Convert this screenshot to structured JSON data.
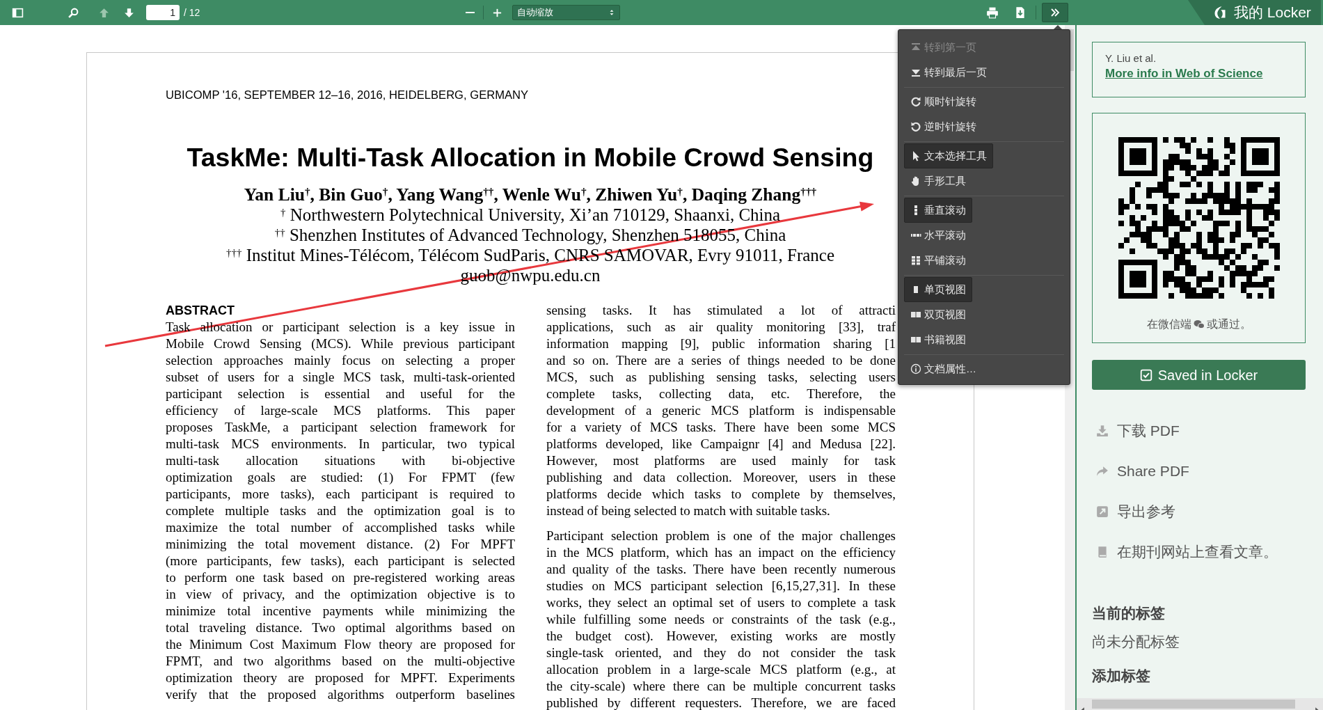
{
  "toolbar": {
    "page_value": "1",
    "page_total": "/ 12",
    "zoom": "自动缩放",
    "previous_disabled": true,
    "menu_open": true
  },
  "locker_tab": {
    "title": "我的 Locker"
  },
  "document": {
    "running_head": "UBICOMP '16, SEPTEMBER 12–16, 2016, HEIDELBERG, GERMANY",
    "title": "TaskMe: Multi-Task Allocation in Mobile Crowd Sensing",
    "authors": "Yan Liu$^{†}$, Bin Guo$^{†}$, Yang Wang$^{††}$, Wenle Wu$^{†}$, Zhiwen Yu$^{†}$, Daqing Zhang$^{†††}$",
    "affiliations": [
      "$^{†}$ Northwestern Polytechnical University, Xi’an 710129, Shaanxi, China",
      "$^{††}$ Shenzhen Institutes of Advanced Technology, Shenzhen 518055, China",
      "$^{†††}$ Institut Mines-Télécom, Télécom SudParis, CNRS SAMOVAR, Evry 91011, France"
    ],
    "email": "guob@nwpu.edu.cn",
    "columns": [
      {
        "heading": "ABSTRACT",
        "paragraphs": [
          {
            "lines": [
              "Task allocation or participant selection is a key issue in",
              "Mobile Crowd Sensing (MCS). While previous participant",
              "selection approaches mainly focus on selecting a proper",
              "subset of users for a single MCS task, multi-task-oriented",
              "participant selection is essential and useful for the",
              "efficiency of large-scale MCS platforms. This paper",
              "proposes TaskMe, a participant selection framework for",
              "multi-task MCS environments. In particular, two typical",
              "multi-task allocation situations with bi-objective",
              "optimization goals are studied: (1) For FPMT (few",
              "participants, more tasks), each participant is required to",
              "complete multiple tasks and the optimization goal is to",
              "maximize the total number of accomplished tasks while",
              "minimizing the total movement distance. (2) For MPFT",
              "(more participants, few tasks), each participant is selected",
              "to perform one task based on pre-registered working areas",
              "in view of privacy, and the optimization objective is to",
              "minimize total incentive payments while minimizing the",
              "total traveling distance. Two optimal algorithms based on",
              "the Minimum Cost Maximum Flow theory are proposed for",
              "FPMT, and two algorithms based on the multi-objective",
              "optimization theory are proposed for MPFT. Experiments",
              "verify that the proposed algorithms outperform baselines"
            ]
          }
        ]
      },
      {
        "paragraphs": [
          {
            "lines": [
              "sensing tasks. It has stimulated a lot of attracti",
              "applications, such as air quality monitoring [33], traf",
              "information mapping [9], public information sharing [1",
              "and so on. There are a series of things needed to be done",
              "MCS, such as publishing sensing tasks, selecting users",
              "complete tasks, collecting data, etc. Therefore, the",
              "development of a generic MCS platform is indispensable",
              "for a variety of MCS tasks. There have been some MCS",
              "platforms developed, like Campaignr [4] and Medusa [22].",
              "However, most platforms are used mainly for task",
              "publishing and data collection. Moreover, users in these",
              "platforms decide which tasks to complete by themselves,",
              "instead of being selected to match with suitable tasks."
            ]
          },
          {
            "lines": [
              "Participant selection problem is one of the major challenges",
              "in the MCS platform, which has an impact on the efficiency",
              "and quality of the tasks. There have been recently numerous",
              "studies on MCS participant selection [6,15,27,31]. In these",
              "works, they select an optimal set of users to complete a task",
              "while fulfilling some needs or constraints of the task (e.g.,",
              "the budget cost). However, existing works are mostly",
              "single-task oriented, and they do not consider the task",
              "allocation problem in a large-scale MCS platform (e.g., at",
              "the city-scale) where there can be multiple concurrent tasks",
              "published by different requesters. Therefore, we are faced"
            ]
          }
        ]
      }
    ]
  },
  "tools_menu": {
    "groups": [
      [
        {
          "label": "转到第一页",
          "selected": false,
          "disabled": true
        },
        {
          "label": "转到最后一页",
          "selected": false,
          "disabled": false
        }
      ],
      [
        {
          "label": "顺时针旋转",
          "selected": false,
          "disabled": false
        },
        {
          "label": "逆时针旋转",
          "selected": false,
          "disabled": false
        }
      ],
      [
        {
          "label": "文本选择工具",
          "selected": true,
          "disabled": false
        },
        {
          "label": "手形工具",
          "selected": false,
          "disabled": false
        }
      ],
      [
        {
          "label": "垂直滚动",
          "selected": true,
          "disabled": false
        },
        {
          "label": "水平滚动",
          "selected": false,
          "disabled": false
        },
        {
          "label": "平铺滚动",
          "selected": false,
          "disabled": false
        }
      ],
      [
        {
          "label": "单页视图",
          "selected": true,
          "disabled": false
        },
        {
          "label": "双页视图",
          "selected": false,
          "disabled": false
        },
        {
          "label": "书籍视图",
          "selected": false,
          "disabled": false
        }
      ],
      [
        {
          "label": "文档属性…",
          "selected": false,
          "disabled": false
        }
      ]
    ]
  },
  "sidebar": {
    "citation": {
      "authors": "Y. Liu et al.",
      "link": "More info in Web of Science"
    },
    "qr_caption": {
      "before": "在微信端",
      "after": "或通过。"
    },
    "save_button": "Saved in Locker",
    "actions": [
      {
        "label": "下载 PDF"
      },
      {
        "label": "Share PDF"
      },
      {
        "label": "导出参考"
      },
      {
        "label": "在期刊网站上查看文章。"
      }
    ],
    "tags_heading": "当前的标签",
    "tags_empty": "尚未分配标签",
    "add_tags_heading": "添加标签"
  }
}
